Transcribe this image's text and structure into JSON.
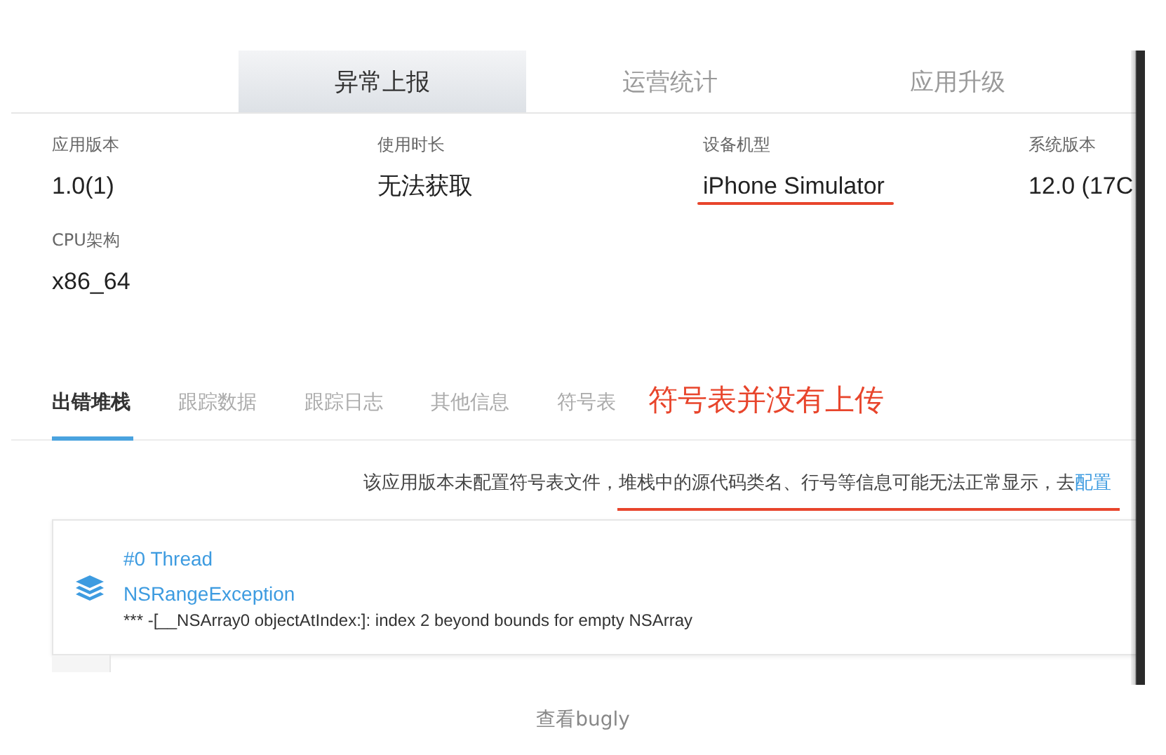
{
  "top_tabs": [
    {
      "label": "异常上报",
      "selected": true
    },
    {
      "label": "运营统计",
      "selected": false
    },
    {
      "label": "应用升级",
      "selected": false
    }
  ],
  "device_info": [
    {
      "label": "应用版本",
      "value": "1.0(1)",
      "underlined": false
    },
    {
      "label": "使用时长",
      "value": "无法获取",
      "underlined": false
    },
    {
      "label": "设备机型",
      "value": "iPhone Simulator",
      "underlined": true
    },
    {
      "label": "系统版本",
      "value": "12.0 (17C",
      "underlined": false
    },
    {
      "label": "CPU架构",
      "value": "x86_64",
      "underlined": false
    }
  ],
  "detail_tabs": [
    {
      "label": "出错堆栈",
      "selected": true
    },
    {
      "label": "跟踪数据",
      "selected": false
    },
    {
      "label": "跟踪日志",
      "selected": false
    },
    {
      "label": "其他信息",
      "selected": false
    },
    {
      "label": "符号表",
      "selected": false
    }
  ],
  "annotation": "符号表并没有上传",
  "notice": {
    "text": "该应用版本未配置符号表文件，堆栈中的源代码类名、行号等信息可能无法正常显示，去",
    "link": "配置",
    "underlined": true
  },
  "thread": {
    "title": "#0 Thread",
    "exception": "NSRangeException",
    "message": "*** -[__NSArray0 objectAtIndex:]: index 2 beyond bounds for empty NSArray"
  },
  "caption": "查看bugly"
}
